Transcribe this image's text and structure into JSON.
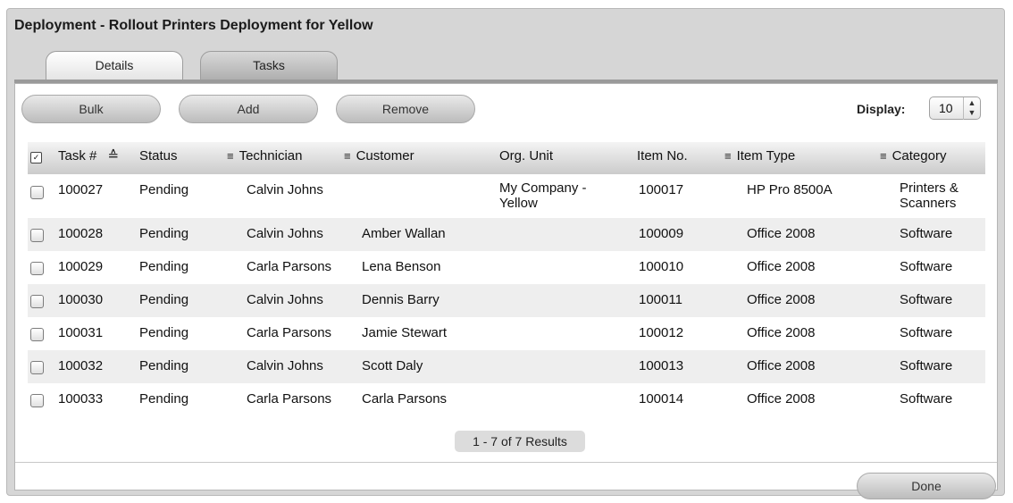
{
  "window": {
    "title": "Deployment - Rollout Printers Deployment for Yellow"
  },
  "tabs": [
    {
      "label": "Details"
    },
    {
      "label": "Tasks"
    }
  ],
  "toolbar": {
    "bulk_label": "Bulk",
    "add_label": "Add",
    "remove_label": "Remove",
    "display_label": "Display:",
    "display_value": "10"
  },
  "table": {
    "columns": [
      "Task #",
      "Status",
      "Technician",
      "Customer",
      "Org. Unit",
      "Item No.",
      "Item Type",
      "Category"
    ],
    "rows": [
      {
        "task": "100027",
        "status": "Pending",
        "technician": "Calvin Johns",
        "customer": "",
        "org_unit_line1": "My Company -",
        "org_unit_line2": "Yellow",
        "item_no": "100017",
        "item_type": "HP Pro 8500A",
        "category_line1": "Printers &",
        "category_line2": "Scanners"
      },
      {
        "task": "100028",
        "status": "Pending",
        "technician": "Calvin Johns",
        "customer": "Amber Wallan",
        "org_unit_line1": "",
        "org_unit_line2": "",
        "item_no": "100009",
        "item_type": "Office 2008",
        "category_line1": "Software",
        "category_line2": ""
      },
      {
        "task": "100029",
        "status": "Pending",
        "technician": "Carla Parsons",
        "customer": "Lena Benson",
        "org_unit_line1": "",
        "org_unit_line2": "",
        "item_no": "100010",
        "item_type": "Office 2008",
        "category_line1": "Software",
        "category_line2": ""
      },
      {
        "task": "100030",
        "status": "Pending",
        "technician": "Calvin Johns",
        "customer": "Dennis Barry",
        "org_unit_line1": "",
        "org_unit_line2": "",
        "item_no": "100011",
        "item_type": "Office 2008",
        "category_line1": "Software",
        "category_line2": ""
      },
      {
        "task": "100031",
        "status": "Pending",
        "technician": "Carla Parsons",
        "customer": "Jamie Stewart",
        "org_unit_line1": "",
        "org_unit_line2": "",
        "item_no": "100012",
        "item_type": "Office 2008",
        "category_line1": "Software",
        "category_line2": ""
      },
      {
        "task": "100032",
        "status": "Pending",
        "technician": "Calvin Johns",
        "customer": "Scott Daly",
        "org_unit_line1": "",
        "org_unit_line2": "",
        "item_no": "100013",
        "item_type": "Office 2008",
        "category_line1": "Software",
        "category_line2": ""
      },
      {
        "task": "100033",
        "status": "Pending",
        "technician": "Carla Parsons",
        "customer": "Carla Parsons",
        "org_unit_line1": "",
        "org_unit_line2": "",
        "item_no": "100014",
        "item_type": "Office 2008",
        "category_line1": "Software",
        "category_line2": ""
      }
    ]
  },
  "pager": {
    "text": "1 - 7 of 7 Results"
  },
  "footer": {
    "done_label": "Done"
  },
  "colors": {
    "link": "#1a2fcf",
    "row_alt": "#eeeeee"
  },
  "icons": {
    "sort": "sort-ascending-icon",
    "filter": "filter-lines-icon",
    "select_all": "select-all-checkbox-icon"
  }
}
